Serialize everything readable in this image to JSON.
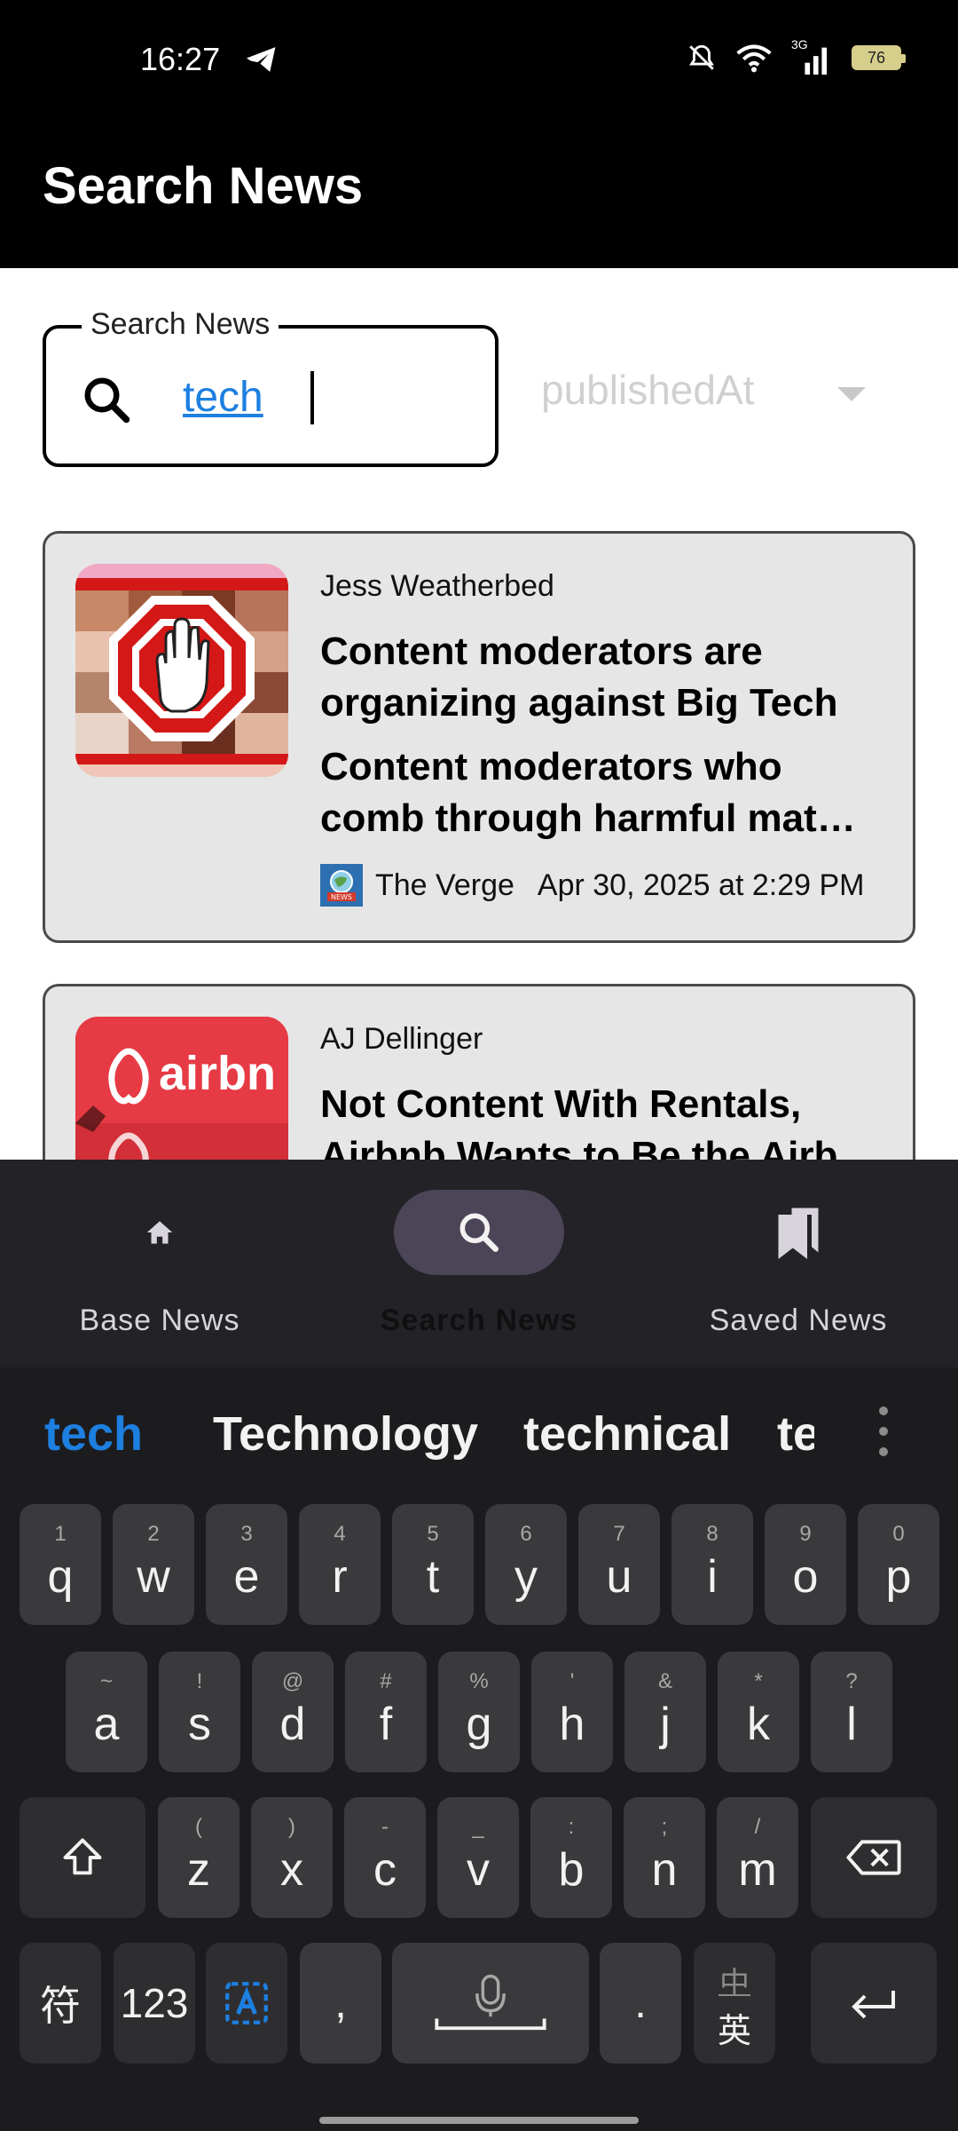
{
  "status_bar": {
    "time": "16:27",
    "network": "3G",
    "battery": "76"
  },
  "app_bar": {
    "title": "Search News"
  },
  "search": {
    "label": "Search News",
    "value": "tech",
    "sort_by": "publishedAt"
  },
  "articles": [
    {
      "author": "Jess Weatherbed",
      "title": "Content moderators are organizing against Big Tech",
      "description": "Content moderators who comb through harmful mat…",
      "source": "The Verge",
      "published": "Apr 30, 2025 at 2:29 PM"
    },
    {
      "author": "AJ Dellinger",
      "title": "Not Content With Rentals, Airbnb Wants to Be the Airb",
      "thumb_text": "airbn"
    }
  ],
  "bottom_nav": {
    "items": [
      {
        "label": "Base News",
        "icon": "home-icon"
      },
      {
        "label": "Search News",
        "icon": "search-icon",
        "selected": true
      },
      {
        "label": "Saved News",
        "icon": "bookmarks-icon"
      }
    ]
  },
  "keyboard": {
    "suggestions": [
      "tech",
      "Technology",
      "technical",
      "te"
    ],
    "row1": [
      {
        "k": "q",
        "h": "1"
      },
      {
        "k": "w",
        "h": "2"
      },
      {
        "k": "e",
        "h": "3"
      },
      {
        "k": "r",
        "h": "4"
      },
      {
        "k": "t",
        "h": "5"
      },
      {
        "k": "y",
        "h": "6"
      },
      {
        "k": "u",
        "h": "7"
      },
      {
        "k": "i",
        "h": "8"
      },
      {
        "k": "o",
        "h": "9"
      },
      {
        "k": "p",
        "h": "0"
      }
    ],
    "row2": [
      {
        "k": "a",
        "h": "~"
      },
      {
        "k": "s",
        "h": "!"
      },
      {
        "k": "d",
        "h": "@"
      },
      {
        "k": "f",
        "h": "#"
      },
      {
        "k": "g",
        "h": "%"
      },
      {
        "k": "h",
        "h": "'"
      },
      {
        "k": "j",
        "h": "&"
      },
      {
        "k": "k",
        "h": "*"
      },
      {
        "k": "l",
        "h": "?"
      }
    ],
    "row3": [
      {
        "k": "z",
        "h": "("
      },
      {
        "k": "x",
        "h": ")"
      },
      {
        "k": "c",
        "h": "-"
      },
      {
        "k": "v",
        "h": "_"
      },
      {
        "k": "b",
        "h": ":"
      },
      {
        "k": "n",
        "h": ";"
      },
      {
        "k": "m",
        "h": "/"
      }
    ],
    "symbols_label": "符",
    "numbers_label": "123",
    "comma": ",",
    "period": ".",
    "lang_top": "中",
    "lang_bottom": "英"
  },
  "colors": {
    "accent": "#1d7fe0",
    "card_bg": "#e6e6e6",
    "nav_bg": "#232227",
    "nav_pill": "#4b4557",
    "keyboard_bg": "#1c1c1e",
    "key_bg": "#3a3a3c"
  }
}
